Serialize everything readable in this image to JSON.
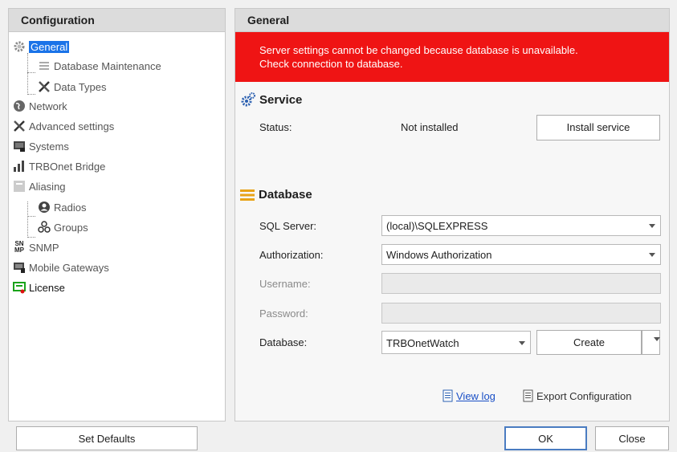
{
  "sidebar": {
    "header": "Configuration",
    "items": [
      {
        "label": "General",
        "icon": "gear-icon"
      },
      {
        "label": "Database Maintenance",
        "icon": "list-icon"
      },
      {
        "label": "Data Types",
        "icon": "tools-icon"
      },
      {
        "label": "Network",
        "icon": "globe-icon"
      },
      {
        "label": "Advanced settings",
        "icon": "tools-icon"
      },
      {
        "label": "Systems",
        "icon": "systems-icon"
      },
      {
        "label": "TRBOnet Bridge",
        "icon": "bars-icon"
      },
      {
        "label": "Aliasing",
        "icon": "aliasing-icon"
      },
      {
        "label": "Radios",
        "icon": "person-icon"
      },
      {
        "label": "Groups",
        "icon": "group-icon"
      },
      {
        "label": "SNMP",
        "icon": "snmp-icon"
      },
      {
        "label": "Mobile Gateways",
        "icon": "gateway-icon"
      },
      {
        "label": "License",
        "icon": "license-icon"
      }
    ],
    "snmp_icon_text": [
      "SN",
      "MP"
    ]
  },
  "main": {
    "header": "General",
    "alert": {
      "line1": "Server settings cannot be changed because database is unavailable.",
      "line2": "Check connection to database."
    },
    "service": {
      "title": "Service",
      "status_label": "Status:",
      "status_value": "Not installed",
      "install_button": "Install service"
    },
    "database": {
      "title": "Database",
      "sql_server_label": "SQL Server:",
      "sql_server_value": "(local)\\SQLEXPRESS",
      "authorization_label": "Authorization:",
      "authorization_value": "Windows Authorization",
      "username_label": "Username:",
      "password_label": "Password:",
      "database_label": "Database:",
      "database_value": "TRBOnetWatch",
      "create_button": "Create"
    },
    "links": {
      "view_log": "View log",
      "export_config": "Export Configuration"
    }
  },
  "footer": {
    "set_defaults": "Set Defaults",
    "ok": "OK",
    "close": "Close"
  },
  "colors": {
    "alert_bg": "#ef1414",
    "selection": "#1a73e8",
    "link": "#1a4fc6"
  }
}
